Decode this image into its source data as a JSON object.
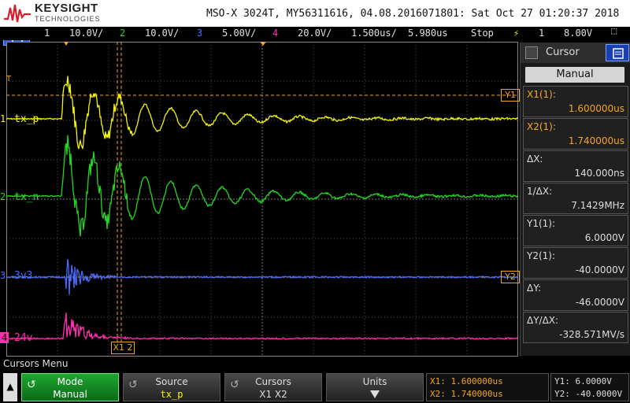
{
  "header": {
    "brand": "KEYSIGHT",
    "brand_sub": "TECHNOLOGIES",
    "title": "MSO-X 3024T, MY56311616, 04.08.2016071801: Sat Oct 27 01:20:37 2018"
  },
  "statusbar": {
    "ch1_num": "1",
    "ch1_scale": "10.0V/",
    "ch2_num": "2",
    "ch2_scale": "10.0V/",
    "ch3_num": "3",
    "ch3_scale": "5.00V/",
    "ch4_num": "4",
    "ch4_scale": "20.0V/",
    "timebase": "1.500us/",
    "delay": "5.980us",
    "run_state": "Stop",
    "trig_source": "1",
    "trig_level": "8.00V"
  },
  "channels": [
    {
      "num": "1",
      "name": "tx_p",
      "color": "#f4f40a"
    },
    {
      "num": "2",
      "name": "tx_n",
      "color": "#23d823"
    },
    {
      "num": "3",
      "name": "3v3",
      "color": "#4a6cff"
    },
    {
      "num": "4",
      "name": "24v",
      "color": "#ff2fb0"
    }
  ],
  "markers": {
    "trigger": "T",
    "y1": "Y1",
    "y2": "Y2",
    "x1x2": "X1 2"
  },
  "panel": {
    "title": "Cursor",
    "mode": "Manual",
    "rows": [
      {
        "label": "X1(1):",
        "value": "1.600000us",
        "orange": true
      },
      {
        "label": "X2(1):",
        "value": "1.740000us",
        "orange": true
      },
      {
        "label": "ΔX:",
        "value": "140.000ns",
        "orange": false
      },
      {
        "label": "1/ΔX:",
        "value": "7.1429MHz",
        "orange": false
      },
      {
        "label": "Y1(1):",
        "value": "6.0000V",
        "orange": false
      },
      {
        "label": "Y2(1):",
        "value": "-40.0000V",
        "orange": false
      },
      {
        "label": "ΔY:",
        "value": "-46.0000V",
        "orange": false
      },
      {
        "label": "ΔY/ΔX:",
        "value": "-328.571MV/s",
        "orange": false
      }
    ]
  },
  "menu": {
    "title": "Cursors Menu",
    "softkeys": [
      {
        "top": "Mode",
        "bottom": "Manual"
      },
      {
        "top": "Source",
        "bottom": "tx_p"
      },
      {
        "top": "Cursors",
        "bottom": "X1 X2"
      },
      {
        "top": "Units",
        "bottom": ""
      }
    ],
    "readout_x1": "X1: 1.600000us",
    "readout_x2": "X2: 1.740000us",
    "readout_y1": "Y1: 6.0000V",
    "readout_y2": "Y2: -40.0000V"
  }
}
